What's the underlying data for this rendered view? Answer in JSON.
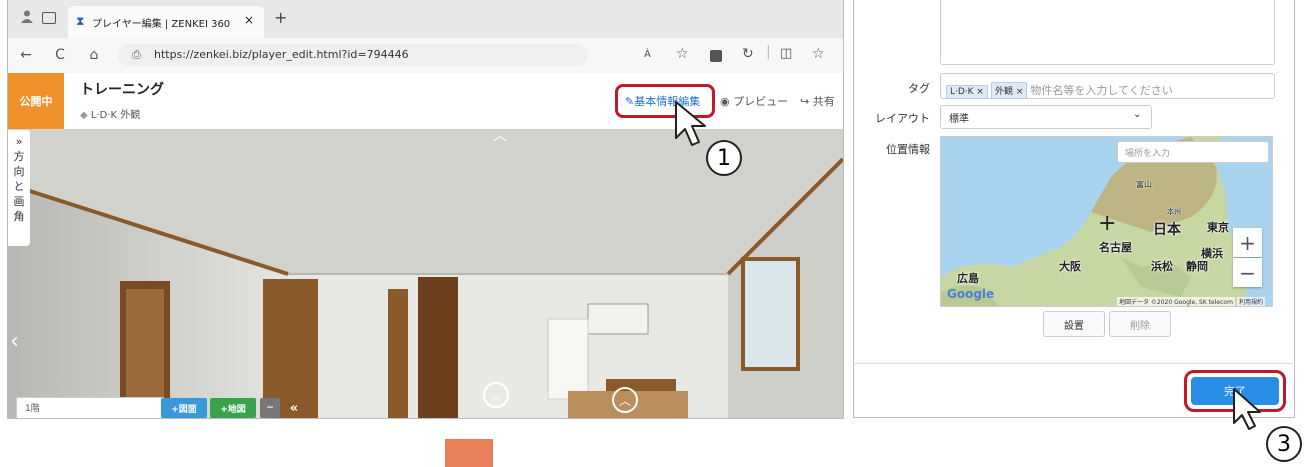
{
  "browser": {
    "tab_title": "プレイヤー編集 | ZENKEI 360",
    "tab_close": "×",
    "new_tab": "+",
    "url": "https://zenkei.biz/player_edit.html?id=794446",
    "reader_icon": "À",
    "nav": {
      "back": "←",
      "reload": "C",
      "home": "⌂"
    }
  },
  "page": {
    "status_label": "公開中",
    "title": "トレーニング",
    "tags_line": "L·D·K 外観",
    "actions": {
      "edit": "基本情報編集",
      "preview": "プレビュー",
      "share": "共有"
    },
    "side_panel": [
      "»",
      "方",
      "向",
      "と",
      "画",
      "角"
    ],
    "floor_value": "1階",
    "floor_buttons": {
      "plan": "+図面",
      "map": "+地図",
      "minus": "−",
      "collapse": "«"
    },
    "pano_nav": {
      "up": "︿",
      "left": "‹"
    }
  },
  "form": {
    "tag_label": "タグ",
    "tags": [
      "L·D·K ×",
      "外観 ×"
    ],
    "tag_placeholder": "物件名等を入力してください",
    "layout_label": "レイアウト",
    "layout_value": "標準",
    "location_label": "位置情報",
    "map_search_placeholder": "場所を入力",
    "map_labels": [
      "富山",
      "本州",
      "日本",
      "東京",
      "名古屋",
      "横浜",
      "大阪",
      "浜松",
      "静岡",
      "広島"
    ],
    "map_credit": "地図データ ©2020 Google, SK telecom",
    "map_terms": "利用規約",
    "google_logo": "Google",
    "zoom_in": "+",
    "zoom_out": "−",
    "set_button": "設置",
    "delete_button": "削除",
    "done_button": "完了"
  },
  "callouts": [
    "1",
    "3"
  ],
  "colors": {
    "status_orange": "#f0922b",
    "link_blue": "#1c70d6",
    "highlight_red": "#c0192c",
    "done_blue": "#2b8ee6",
    "btn_blue": "#3a9ad9",
    "btn_green": "#3aa24a",
    "btn_gray": "#777777",
    "marker_orange": "#e8805c"
  }
}
